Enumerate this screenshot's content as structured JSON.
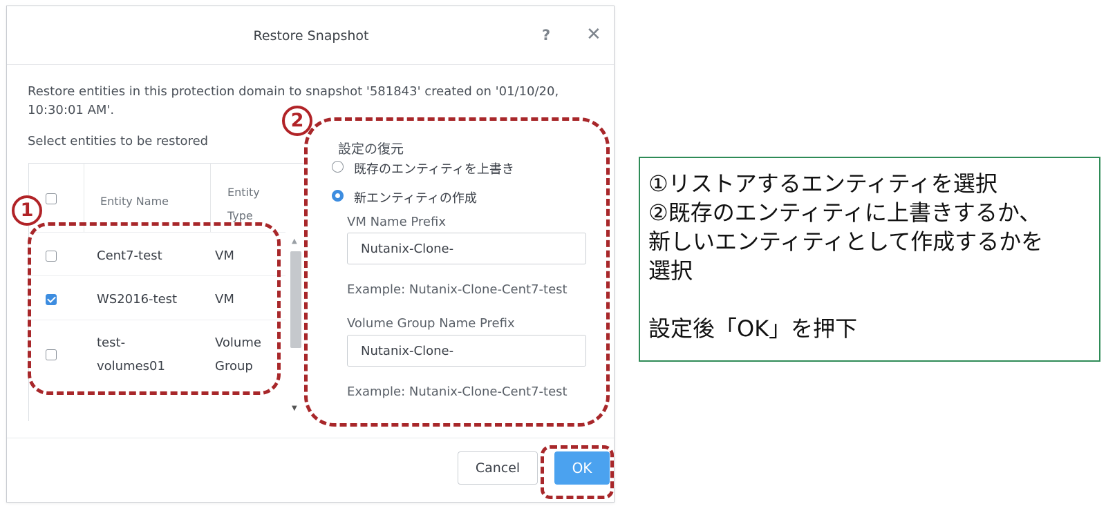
{
  "dialog": {
    "title": "Restore Snapshot",
    "help_icon": "?",
    "close_icon": "✕",
    "description": "Restore entities in this protection domain to snapshot '581843' created on '01/10/20, 10:30:01 AM'.",
    "select_label": "Select entities to be restored",
    "table": {
      "headers": {
        "name": "Entity Name",
        "type": "Entity Type"
      },
      "rows": [
        {
          "name": "Cent7-test",
          "type": "VM",
          "checked": false
        },
        {
          "name": "WS2016-test",
          "type": "VM",
          "checked": true
        },
        {
          "name": "test-volumes01",
          "type": "Volume Group",
          "checked": false
        }
      ]
    },
    "settings": {
      "title": "設定の復元",
      "options": [
        {
          "label": "既存のエンティティを上書き",
          "selected": false
        },
        {
          "label": "新エンティティの作成",
          "selected": true
        }
      ],
      "vm_prefix_label": "VM Name Prefix",
      "vm_prefix_value": "Nutanix-Clone-",
      "vm_example": "Example: Nutanix-Clone-Cent7-test",
      "vg_prefix_label": "Volume Group Name Prefix",
      "vg_prefix_value": "Nutanix-Clone-",
      "vg_example": "Example: Nutanix-Clone-Cent7-test"
    },
    "buttons": {
      "cancel": "Cancel",
      "ok": "OK"
    }
  },
  "annotations": {
    "marker1": "1",
    "marker2": "2",
    "note_lines": [
      "①リストアするエンティティを選択",
      "②既存のエンティティに上書きするか、",
      "新しいエンティティとして作成するかを",
      "選択",
      "",
      "設定後「OK」を押下"
    ]
  },
  "colors": {
    "accent": "#4ba2ef",
    "annotation_red": "#a8272a",
    "note_border": "#2e8b57"
  }
}
